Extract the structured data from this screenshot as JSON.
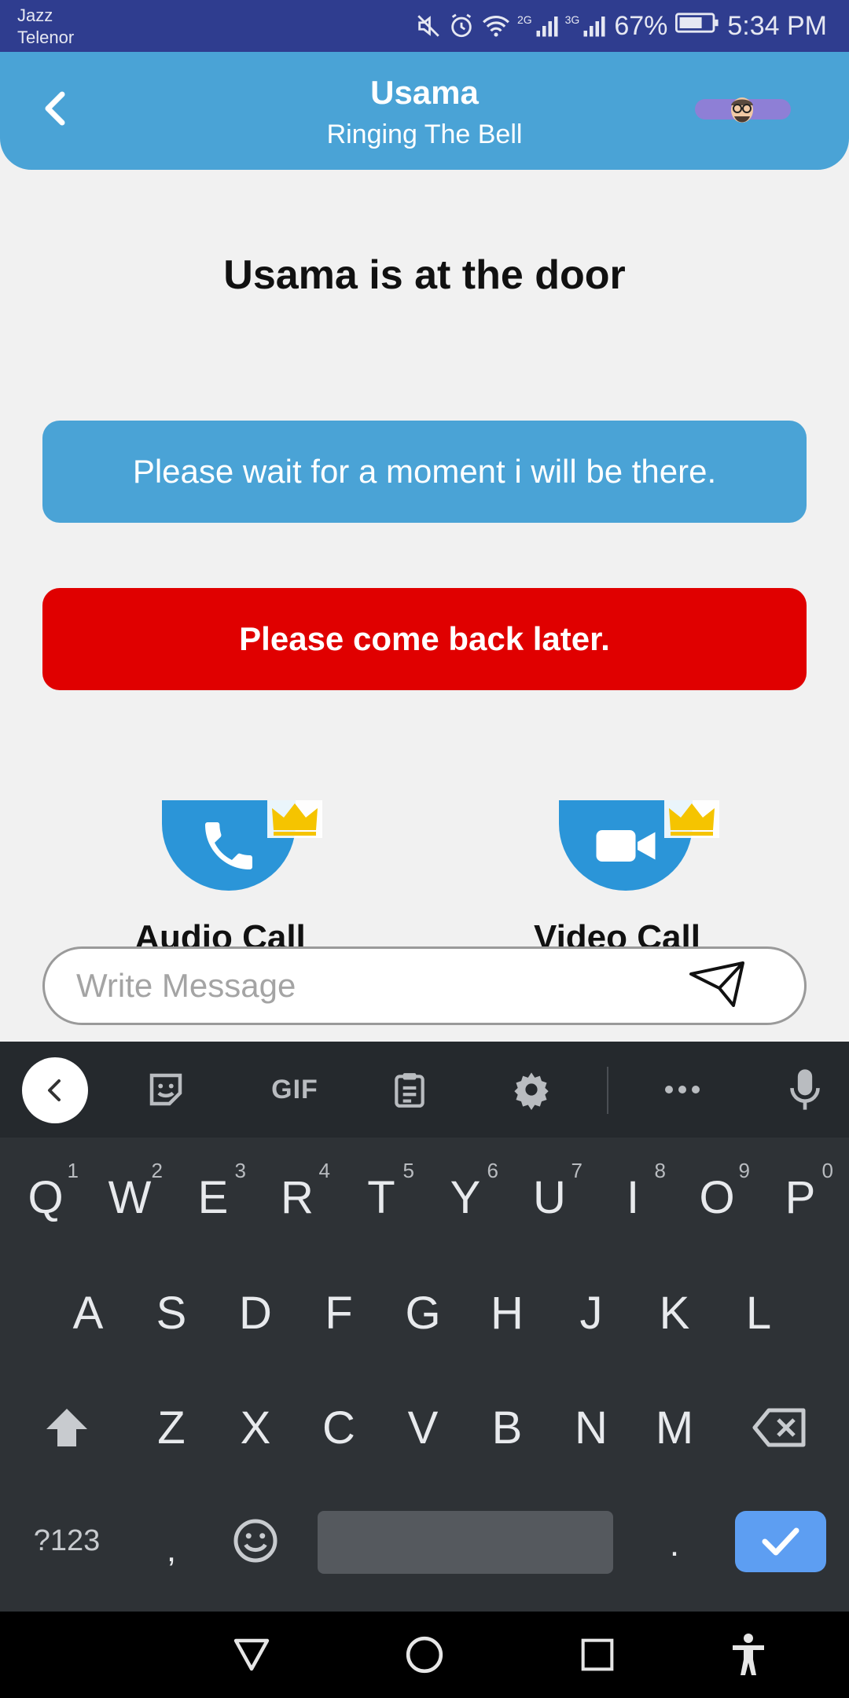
{
  "status_bar": {
    "carrier_1": "Jazz",
    "carrier_2": "Telenor",
    "net_1": "2G",
    "net_2": "3G",
    "battery": "67%",
    "time": "5:34 PM"
  },
  "header": {
    "title": "Usama",
    "subtitle": "Ringing The Bell"
  },
  "main": {
    "door_title": "Usama is at the door",
    "reply_wait": "Please wait for a moment i will be there.",
    "reply_later": "Please come back later.",
    "audio_call_label": "Audio Call",
    "video_call_label": "Video Call",
    "message_placeholder": "Write Message"
  },
  "keyboard": {
    "gif_label": "GIF",
    "row1": [
      "Q",
      "W",
      "E",
      "R",
      "T",
      "Y",
      "U",
      "I",
      "O",
      "P"
    ],
    "row1_hints": [
      "1",
      "2",
      "3",
      "4",
      "5",
      "6",
      "7",
      "8",
      "9",
      "0"
    ],
    "row2": [
      "A",
      "S",
      "D",
      "F",
      "G",
      "H",
      "J",
      "K",
      "L"
    ],
    "row3": [
      "Z",
      "X",
      "C",
      "V",
      "B",
      "N",
      "M"
    ],
    "symbols_key": "?123",
    "comma_key": ",",
    "period_key": "."
  },
  "colors": {
    "status_bar": "#2f3d8f",
    "header": "#4aa3d6",
    "reply_wait": "#4aa3d6",
    "reply_later": "#e00000",
    "call_button": "#2b95d8",
    "crown": "#f5c400",
    "keyboard": "#2e3236",
    "enter_key": "#5d9ef2"
  }
}
